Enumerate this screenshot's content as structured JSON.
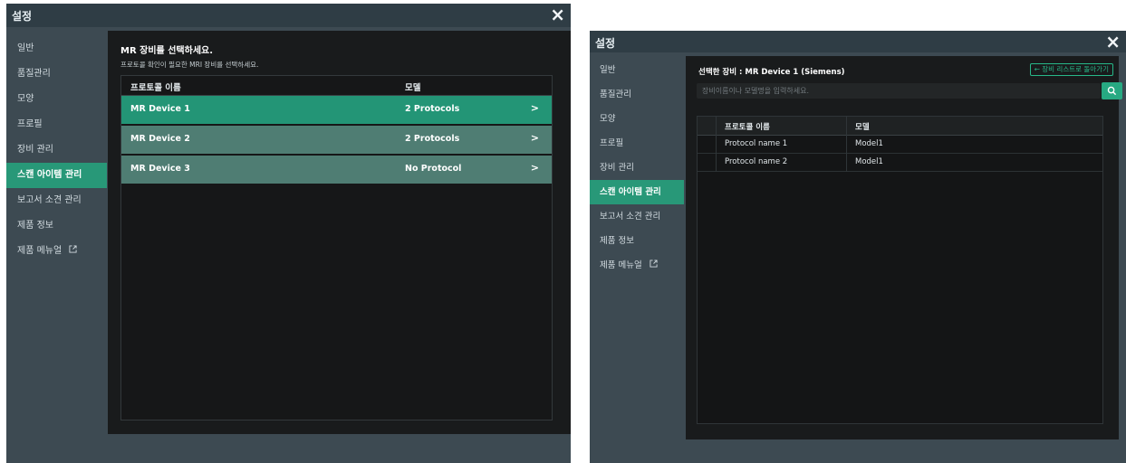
{
  "window1": {
    "title": "설정",
    "close_icon": "×",
    "sidebar": [
      {
        "label": "일반"
      },
      {
        "label": "품질관리"
      },
      {
        "label": "모양"
      },
      {
        "label": "프로필"
      },
      {
        "label": "장비 관리"
      },
      {
        "label": "스캔 아이템 관리",
        "active": true
      },
      {
        "label": "보고서 소견 관리"
      },
      {
        "label": "제품 정보"
      },
      {
        "label": "제품 메뉴얼",
        "icon": "external-link-icon"
      }
    ],
    "heading": "MR 장비를 선택하세요.",
    "subheading": "프로토콜 확인이 필요한 MRI 장비를 선택하세요.",
    "table": {
      "headers": [
        "프로토콜 이름",
        "모델"
      ],
      "rows": [
        {
          "name": "MR Device 1",
          "model": "2 Protocols",
          "selected": true
        },
        {
          "name": "MR Device 2",
          "model": "2 Protocols"
        },
        {
          "name": "MR Device 3",
          "model": "No Protocol"
        }
      ]
    }
  },
  "window2": {
    "title": "설정",
    "close_icon": "×",
    "sidebar": [
      {
        "label": "일반"
      },
      {
        "label": "품질관리"
      },
      {
        "label": "모양"
      },
      {
        "label": "프로필"
      },
      {
        "label": "장비 관리"
      },
      {
        "label": "스캔 아이템 관리",
        "active": true
      },
      {
        "label": "보고서 소견 관리"
      },
      {
        "label": "제품 정보"
      },
      {
        "label": "제품 메뉴얼",
        "icon": "external-link-icon"
      }
    ],
    "heading": "선택한 장비 : MR Device 1 (Siemens)",
    "back_button": "← 장비 리스트로 돌아가기",
    "search": {
      "placeholder": "장비이름이나 모델명을 입력하세요.",
      "value": ""
    },
    "table": {
      "headers": [
        "프로토콜 이름",
        "모델"
      ],
      "rows": [
        {
          "name": "Protocol name 1",
          "model": "Model1"
        },
        {
          "name": "Protocol name 2",
          "model": "Model1"
        }
      ]
    }
  },
  "colors": {
    "accent": "#289878",
    "row_selected": "#239576",
    "row_normal": "#4f7d73",
    "window_bg": "#3d4a52",
    "titlebar_bg": "#2f3d45",
    "panel_bg": "#191b1c"
  }
}
